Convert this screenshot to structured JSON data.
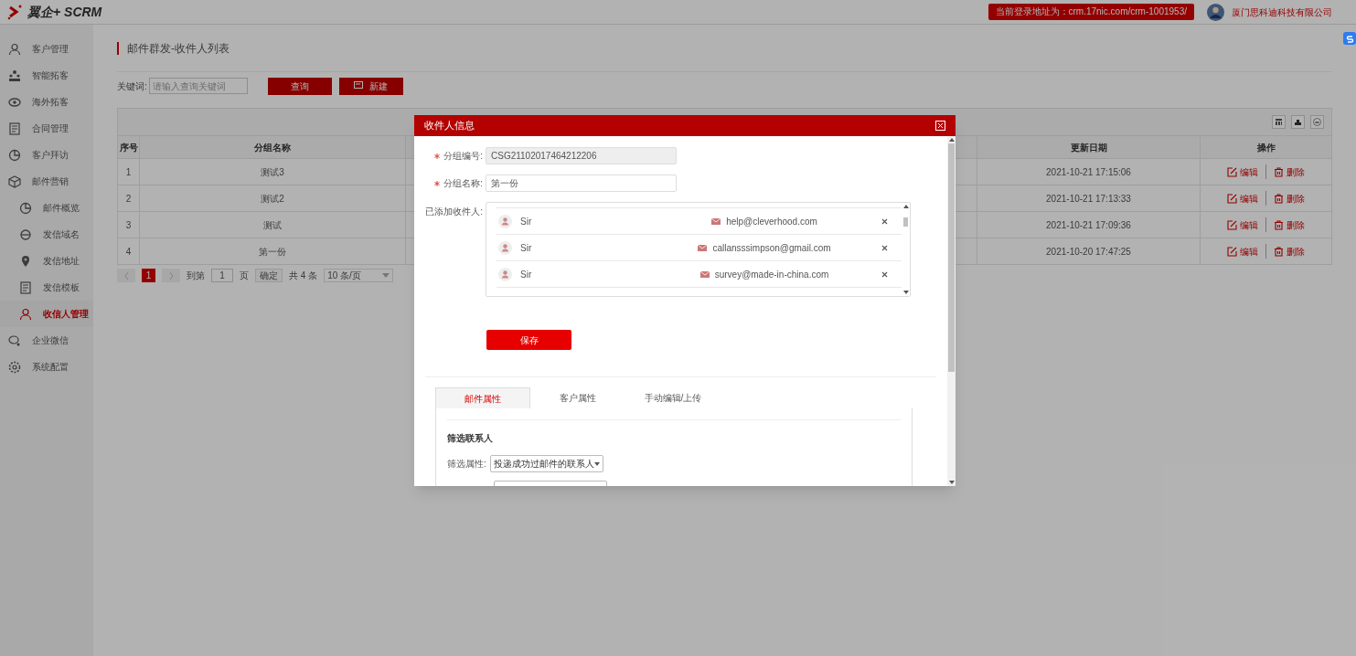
{
  "header": {
    "logo": "翼企+ SCRM",
    "login_address": "当前登录地址为：crm.17nic.com/crm-1001953/",
    "company": "厦门思科迪科技有限公司"
  },
  "sidebar": {
    "items": [
      {
        "label": "客户管理",
        "selected": false
      },
      {
        "label": "智能拓客",
        "selected": false
      },
      {
        "label": "海外拓客",
        "selected": false
      },
      {
        "label": "合同管理",
        "selected": false
      },
      {
        "label": "客户拜访",
        "selected": false
      },
      {
        "label": "邮件营销",
        "selected": false,
        "children": [
          {
            "label": "邮件概览",
            "selected": false
          },
          {
            "label": "发信域名",
            "selected": false
          },
          {
            "label": "发信地址",
            "selected": false
          },
          {
            "label": "发信模板",
            "selected": false
          },
          {
            "label": "收信人管理",
            "selected": true
          }
        ]
      },
      {
        "label": "企业微信",
        "selected": false
      },
      {
        "label": "系统配置",
        "selected": false
      }
    ]
  },
  "page": {
    "title": "邮件群发-收件人列表",
    "keyword_label": "关键词:",
    "keyword_placeholder": "请输入查询关键词",
    "query_button": "查询",
    "new_button": "新建"
  },
  "table": {
    "columns": [
      "序号",
      "分组名称",
      "更新日期",
      "操作"
    ],
    "rows": [
      {
        "index": "1",
        "name": "测试3",
        "updated": "2021-10-21 17:15:06",
        "edit": "编辑",
        "delete": "删除"
      },
      {
        "index": "2",
        "name": "测试2",
        "updated": "2021-10-21 17:13:33",
        "edit": "编辑",
        "delete": "删除"
      },
      {
        "index": "3",
        "name": "测试",
        "updated": "2021-10-21 17:09:36",
        "edit": "编辑",
        "delete": "删除"
      },
      {
        "index": "4",
        "name": "第一份",
        "updated": "2021-10-20 17:47:25",
        "edit": "编辑",
        "delete": "删除"
      }
    ]
  },
  "pagination": {
    "pages": [
      {
        "label": "1",
        "selected": true
      }
    ],
    "goto_label": "到第",
    "goto_value": "1",
    "page_unit": "页",
    "confirm": "确定",
    "total": "共 4 条",
    "page_size": "10 条/页"
  },
  "dialog": {
    "title": "收件人信息",
    "fields": [
      {
        "label": "分组编号:",
        "value": "CSG21102017464212206",
        "disabled": true
      },
      {
        "label": "分组名称:",
        "value": "第一份",
        "disabled": false
      }
    ],
    "recipients_label": "已添加收件人:",
    "recipients": [
      {
        "name": "Sir",
        "email": "help@cleverhood.com"
      },
      {
        "name": "Sir",
        "email": "callansssimpson@gmail.com"
      },
      {
        "name": "Sir",
        "email": "survey@made-in-china.com"
      }
    ],
    "save_button": "保存",
    "tabs": [
      {
        "label": "邮件属性",
        "selected": true
      },
      {
        "label": "客户属性",
        "selected": false
      },
      {
        "label": "手动编辑/上传",
        "selected": false
      }
    ],
    "section_title": "筛选联系人",
    "filter_label": "筛选属性:",
    "filter_value": "投递成功过邮件的联系人"
  }
}
